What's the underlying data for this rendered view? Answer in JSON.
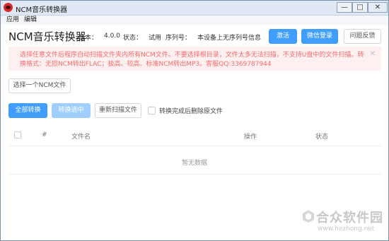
{
  "window": {
    "title": "NCM音乐转换器",
    "min": "—",
    "max": "□",
    "close": "✕"
  },
  "menu": {
    "app": "应用",
    "edit": "编辑"
  },
  "header": {
    "title": "NCM音乐转换器",
    "version_label": "版本：",
    "version": "4.0.0",
    "status_label": "状态：",
    "status": "试用",
    "serial_label": "序列号：",
    "serial_value": "本设备上无序列号信息",
    "activate_btn": "激活",
    "wechat_login_btn": "微信登录",
    "feedback_btn": "问题反馈"
  },
  "alert": {
    "text": "选择任意文件后程序自动扫描文件夹内所有NCM文件。不要选择根目录，文件太多无法扫描，不支持U盘中的文件扫描。转换格式：无损NCM转出FLAC；极高、较高、标准NCM转出MP3。客服QQ:3369787944",
    "close": "✕"
  },
  "actions": {
    "select_file": "选择一个NCM文件",
    "convert_all": "全部转换",
    "convert_selected": "转换选中",
    "rescan": "重新扫描文件",
    "delete_after": "转换完成后删除原文件"
  },
  "table": {
    "columns": [
      "#",
      "文件名",
      "操作",
      "状态"
    ],
    "empty": "暂无数据"
  },
  "watermark": {
    "brand": "合众软件园",
    "url": "www.hezhong.net"
  },
  "colors": {
    "primary": "#409eff",
    "alert_bg": "#fef0f0",
    "alert_text": "#f56c6c",
    "disabled": "#a0cfff"
  }
}
